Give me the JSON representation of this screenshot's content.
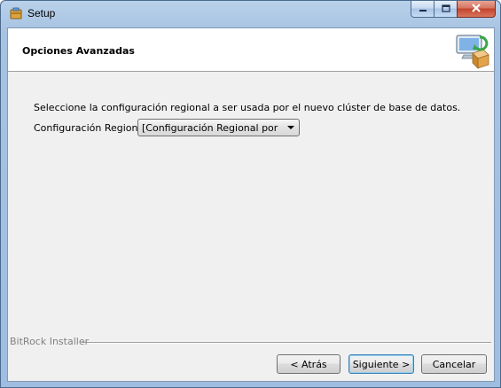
{
  "window": {
    "title": "Setup"
  },
  "header": {
    "title": "Opciones Avanzadas"
  },
  "main": {
    "intro_text": "Seleccione la configuración regional a ser usada por el nuevo clúster de base de datos.",
    "region_label": "Configuración Regional",
    "region_select_value": "[Configuración Regional por defecto]"
  },
  "footer": {
    "brand": "BitRock Installer",
    "back_label": "< Atrás",
    "next_label": "Siguiente >",
    "cancel_label": "Cancelar"
  },
  "icons": {
    "app": "setup-box-icon",
    "header": "computer-install-icon"
  }
}
